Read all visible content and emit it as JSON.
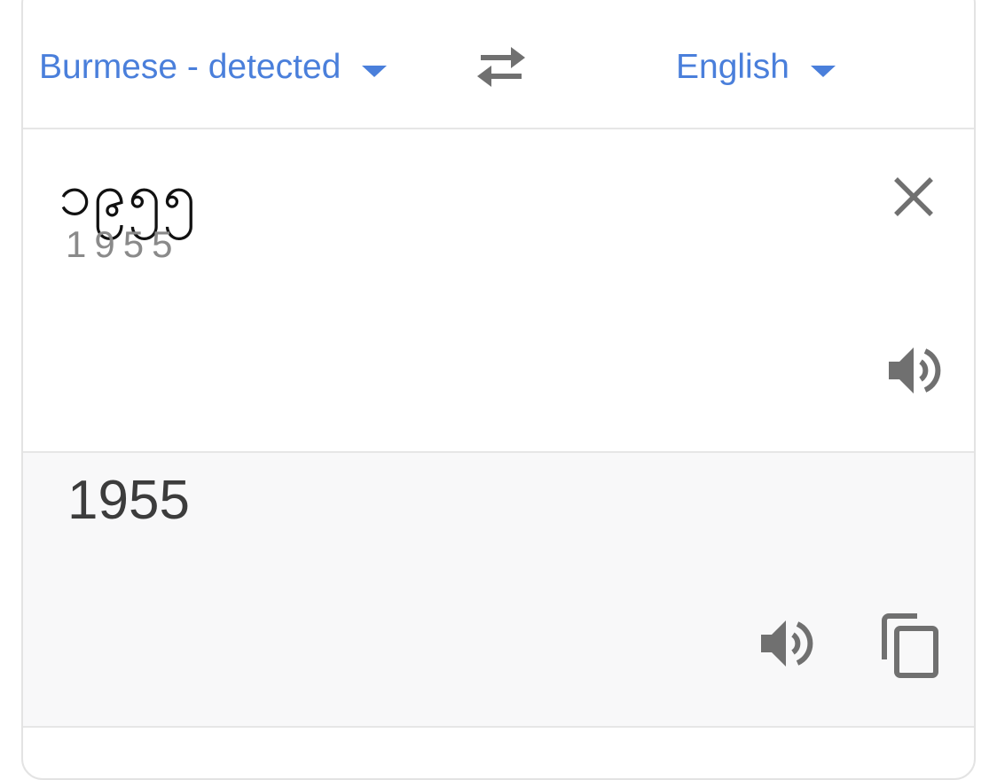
{
  "header": {
    "source_language": "Burmese - detected",
    "target_language": "English"
  },
  "input": {
    "text": "၁၉၅၅",
    "romanization": "1955"
  },
  "output": {
    "text": "1955"
  },
  "icons": {
    "source_caret": "caret-down-icon",
    "swap": "swap-languages-icon",
    "target_caret": "caret-down-icon",
    "clear": "close-icon",
    "source_speak": "speaker-icon",
    "output_speak": "speaker-icon",
    "copy": "copy-icon"
  },
  "colors": {
    "accent": "#4a7fdb",
    "icon_gray": "#707070",
    "output_background": "#f8f8f9"
  }
}
